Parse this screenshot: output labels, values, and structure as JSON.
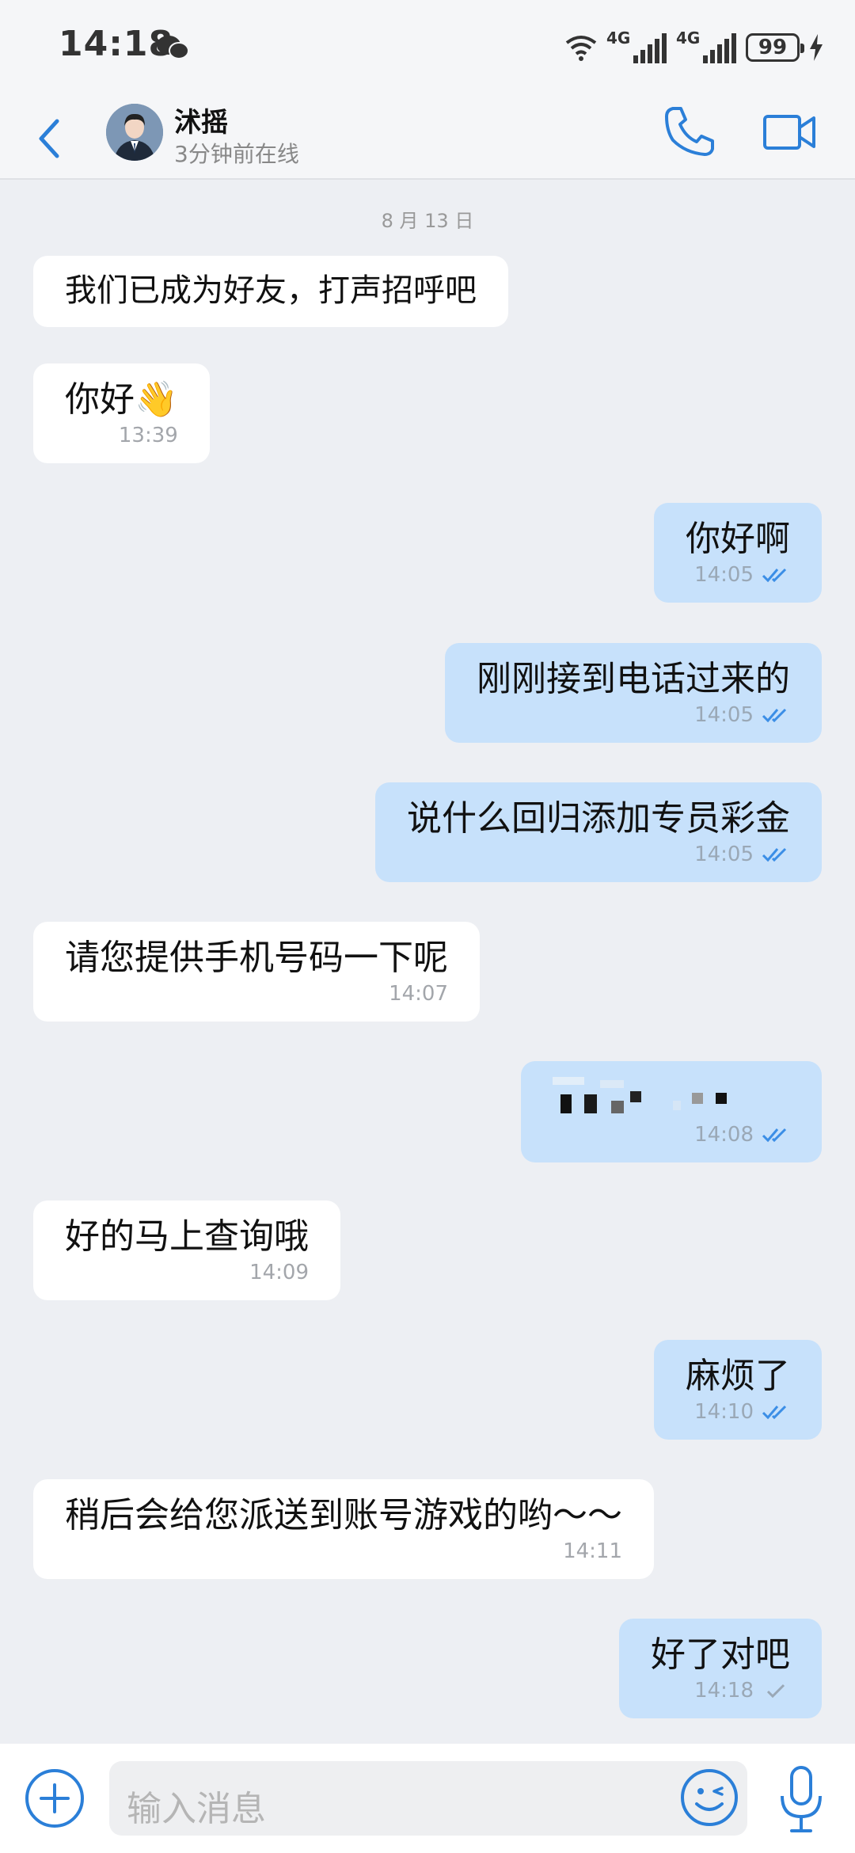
{
  "status_bar": {
    "time": "14:18",
    "network_1": "4G",
    "network_2": "4G",
    "battery": "99"
  },
  "header": {
    "contact_name": "沭摇",
    "contact_status": "3分钟前在线"
  },
  "date_divider": "8 月 13 日",
  "messages": [
    {
      "side": "in",
      "text": "我们已成为好友，打声招呼吧",
      "time": ""
    },
    {
      "side": "in",
      "text": "你好👋",
      "time": "13:39"
    },
    {
      "side": "out",
      "text": "你好啊",
      "time": "14:05",
      "status": "read"
    },
    {
      "side": "out",
      "text": "刚刚接到电话过来的",
      "time": "14:05",
      "status": "read"
    },
    {
      "side": "out",
      "text": "说什么回归添加专员彩金",
      "time": "14:05",
      "status": "read"
    },
    {
      "side": "in",
      "text": "请您提供手机号码一下呢",
      "time": "14:07"
    },
    {
      "side": "out",
      "text": "",
      "time": "14:08",
      "status": "read",
      "pixelated": true
    },
    {
      "side": "in",
      "text": "好的马上查询哦",
      "time": "14:09"
    },
    {
      "side": "out",
      "text": "麻烦了",
      "time": "14:10",
      "status": "read"
    },
    {
      "side": "in",
      "text": "稍后会给您派送到账号游戏的哟～～",
      "time": "14:11"
    },
    {
      "side": "out",
      "text": "好了对吧",
      "time": "14:18",
      "status": "sent"
    }
  ],
  "input": {
    "placeholder": "输入消息"
  },
  "colors": {
    "accent": "#2b7fd8",
    "incoming_bubble": "#ffffff",
    "outgoing_bubble": "#c7e1fb",
    "background": "#edeff3"
  }
}
